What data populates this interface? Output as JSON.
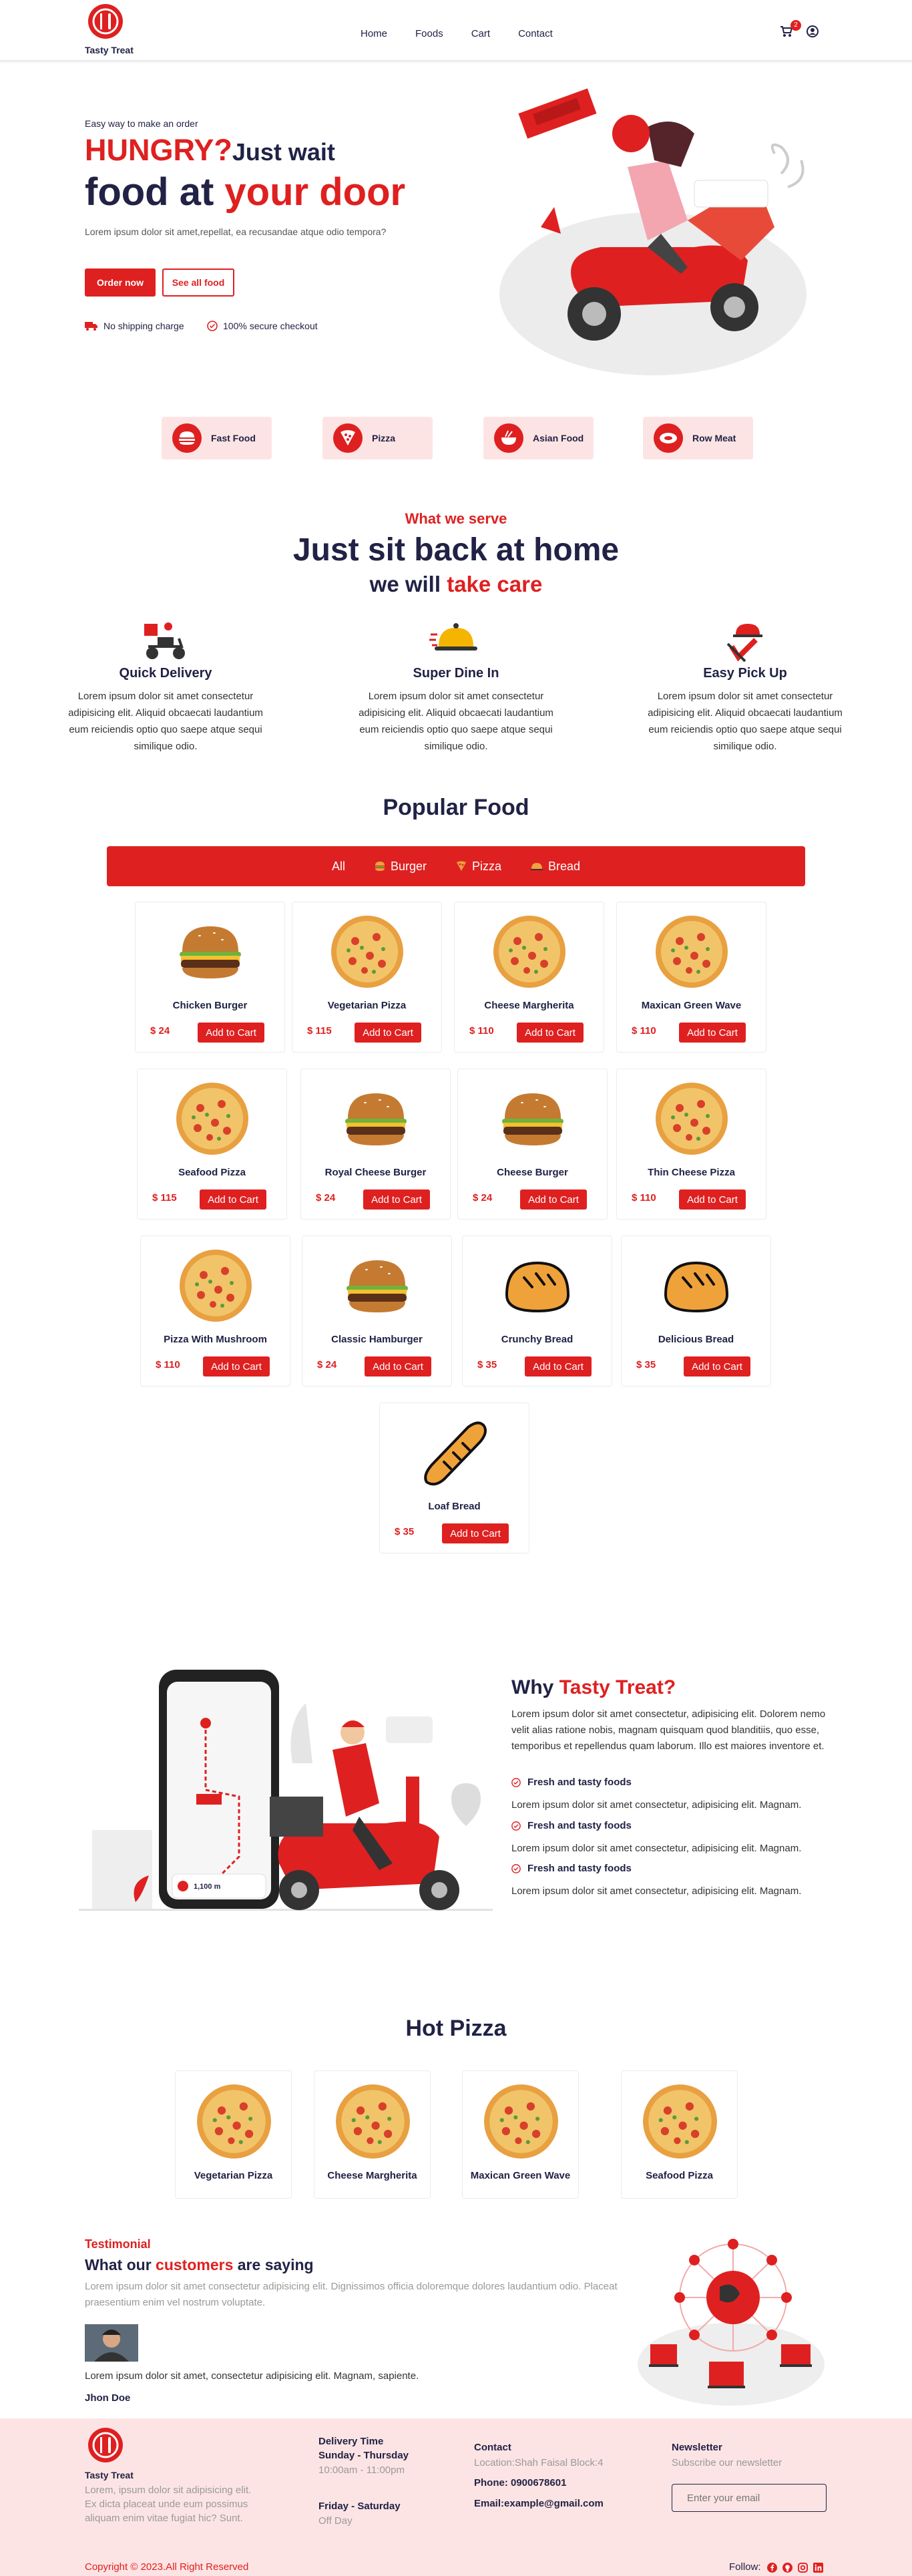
{
  "brand": {
    "name": "Tasty Treat",
    "accent": "#df2020",
    "navy": "#212245",
    "pink": "#fde4e4"
  },
  "nav": {
    "items": [
      "Home",
      "Foods",
      "Cart",
      "Contact"
    ],
    "cart_count": "2",
    "cart_icon": "cart-icon",
    "user_icon": "user-icon"
  },
  "hero": {
    "eyebrow": "Easy way to make an order",
    "h_hungry": "HUNGRY?",
    "h_wait": "Just wait",
    "h_food": "food at ",
    "h_door": "your door",
    "text": "Lorem ipsum dolor sit amet,repellat, ea recusandae atque odio tempora?",
    "order_btn": "Order now",
    "see_btn": "See all food",
    "feat1": "No shipping charge",
    "feat2": "100% secure checkout"
  },
  "categories": [
    {
      "label": "Fast Food",
      "icon": "burger-icon"
    },
    {
      "label": "Pizza",
      "icon": "pizza-icon"
    },
    {
      "label": "Asian Food",
      "icon": "noodles-icon"
    },
    {
      "label": "Row Meat",
      "icon": "meat-icon"
    }
  ],
  "serve": {
    "eyebrow": "What we serve",
    "title": "Just sit back at home",
    "sub_a": "we will ",
    "sub_b": "take care",
    "services": [
      {
        "title": "Quick Delivery",
        "text": "Lorem ipsum dolor sit amet consectetur adipisicing elit. Aliquid obcaecati laudantium eum reiciendis optio quo saepe atque sequi similique odio.",
        "icon": "delivery-icon"
      },
      {
        "title": "Super Dine In",
        "text": "Lorem ipsum dolor sit amet consectetur adipisicing elit. Aliquid obcaecati laudantium eum reiciendis optio quo saepe atque sequi similique odio.",
        "icon": "dish-icon"
      },
      {
        "title": "Easy Pick Up",
        "text": "Lorem ipsum dolor sit amet consectetur adipisicing elit. Aliquid obcaecati laudantium eum reiciendis optio quo saepe atque sequi similique odio.",
        "icon": "pickup-icon"
      }
    ]
  },
  "popular": {
    "title": "Popular Food",
    "tabs": [
      "All",
      "Burger",
      "Pizza",
      "Bread"
    ],
    "add_label": "Add to Cart",
    "products": [
      {
        "name": "Chicken Burger",
        "price": "$ 24",
        "kind": "burger"
      },
      {
        "name": "Vegetarian Pizza",
        "price": "$ 115",
        "kind": "pizza"
      },
      {
        "name": "Cheese Margherita",
        "price": "$ 110",
        "kind": "pizza"
      },
      {
        "name": "Maxican Green Wave",
        "price": "$ 110",
        "kind": "pizza"
      },
      {
        "name": "Seafood Pizza",
        "price": "$ 115",
        "kind": "pizza"
      },
      {
        "name": "Royal Cheese Burger",
        "price": "$ 24",
        "kind": "burger"
      },
      {
        "name": "Cheese Burger",
        "price": "$ 24",
        "kind": "burger"
      },
      {
        "name": "Thin Cheese Pizza",
        "price": "$ 110",
        "kind": "pizza"
      },
      {
        "name": "Pizza With Mushroom",
        "price": "$ 110",
        "kind": "pizza"
      },
      {
        "name": "Classic Hamburger",
        "price": "$ 24",
        "kind": "burger"
      },
      {
        "name": "Crunchy Bread",
        "price": "$ 35",
        "kind": "bread"
      },
      {
        "name": "Delicious Bread",
        "price": "$ 35",
        "kind": "bread"
      },
      {
        "name": "Loaf Bread",
        "price": "$ 35",
        "kind": "loaf"
      }
    ]
  },
  "why": {
    "title_a": "Why ",
    "title_b": "Tasty Treat?",
    "text": "Lorem ipsum dolor sit amet consectetur, adipisicing elit. Dolorem nemo velit alias ratione nobis, magnam quisquam quod blanditiis, quo esse, temporibus et repellendus quam laborum. Illo est maiores inventore et.",
    "items": [
      {
        "title": "Fresh and tasty foods",
        "text": "Lorem ipsum dolor sit amet consectetur, adipisicing elit. Magnam."
      },
      {
        "title": "Fresh and tasty foods",
        "text": "Lorem ipsum dolor sit amet consectetur, adipisicing elit. Magnam."
      },
      {
        "title": "Fresh and tasty foods",
        "text": "Lorem ipsum dolor sit amet consectetur, adipisicing elit. Magnam."
      }
    ],
    "map_distance": "1,100 m"
  },
  "hot": {
    "title": "Hot Pizza",
    "items": [
      "Vegetarian Pizza",
      "Cheese Margherita",
      "Maxican Green Wave",
      "Seafood Pizza"
    ]
  },
  "testimonial": {
    "eyebrow": "Testimonial",
    "title_a": "What our ",
    "title_b": "customers",
    "title_c": " are saying",
    "intro": "Lorem ipsum dolor sit amet consectetur adipisicing elit. Dignissimos officia doloremque dolores laudantium odio. Placeat praesentium enim vel nostrum voluptate.",
    "quote": "Lorem ipsum dolor sit amet, consectetur adipisicing elit. Magnam, sapiente.",
    "author": "Jhon Doe"
  },
  "footer": {
    "brand_text": "Lorem, ipsum dolor sit adipisicing elit. Ex dicta placeat unde eum possimus aliquam enim vitae fugiat hic? Sunt.",
    "delivery_title": "Delivery Time",
    "d1_days": "Sunday - Thursday",
    "d1_hours": "10:00am - 11:00pm",
    "d2_days": "Friday - Saturday",
    "d2_hours": "Off Day",
    "contact_title": "Contact",
    "location": "Location:Shah Faisal Block:4",
    "phone": "Phone: 0900678601",
    "email": "Email:example@gmail.com",
    "newsletter_title": "Newsletter",
    "newsletter_sub": "Subscribe our newsletter",
    "email_placeholder": "Enter your email",
    "copyright": "Copyright © 2023.All Right Reserved",
    "follow": "Follow:",
    "socials": [
      "facebook-icon",
      "github-icon",
      "instagram-icon",
      "linkedin-icon"
    ]
  }
}
